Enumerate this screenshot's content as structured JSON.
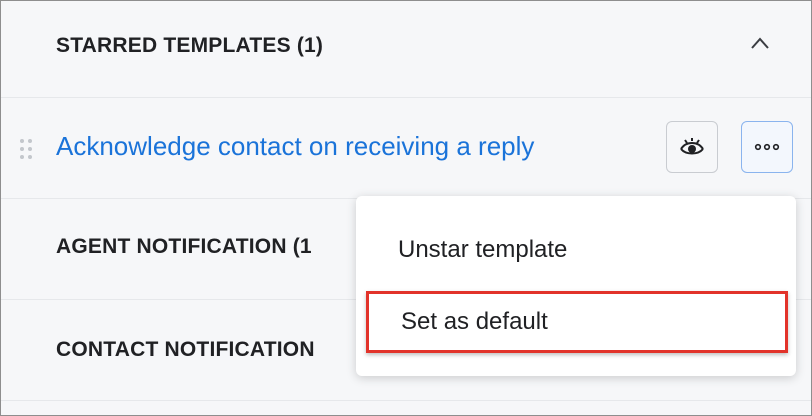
{
  "sections": {
    "starred": {
      "title": "STARRED TEMPLATES (1)",
      "icon": "chevron-up-icon"
    },
    "agent": {
      "title": "AGENT NOTIFICATION (1"
    },
    "contact": {
      "title": "CONTACT NOTIFICATION"
    }
  },
  "template": {
    "name": "Acknowledge contact on receiving a reply",
    "view_icon": "eye-icon",
    "more_icon": "more-horizontal-icon"
  },
  "context_menu": {
    "items": [
      {
        "label": "Unstar template"
      },
      {
        "label": "Set as default",
        "highlighted": true
      }
    ]
  },
  "colors": {
    "link": "#1a73d9",
    "highlight_border": "#e2332a",
    "background": "#f6f7f9"
  }
}
